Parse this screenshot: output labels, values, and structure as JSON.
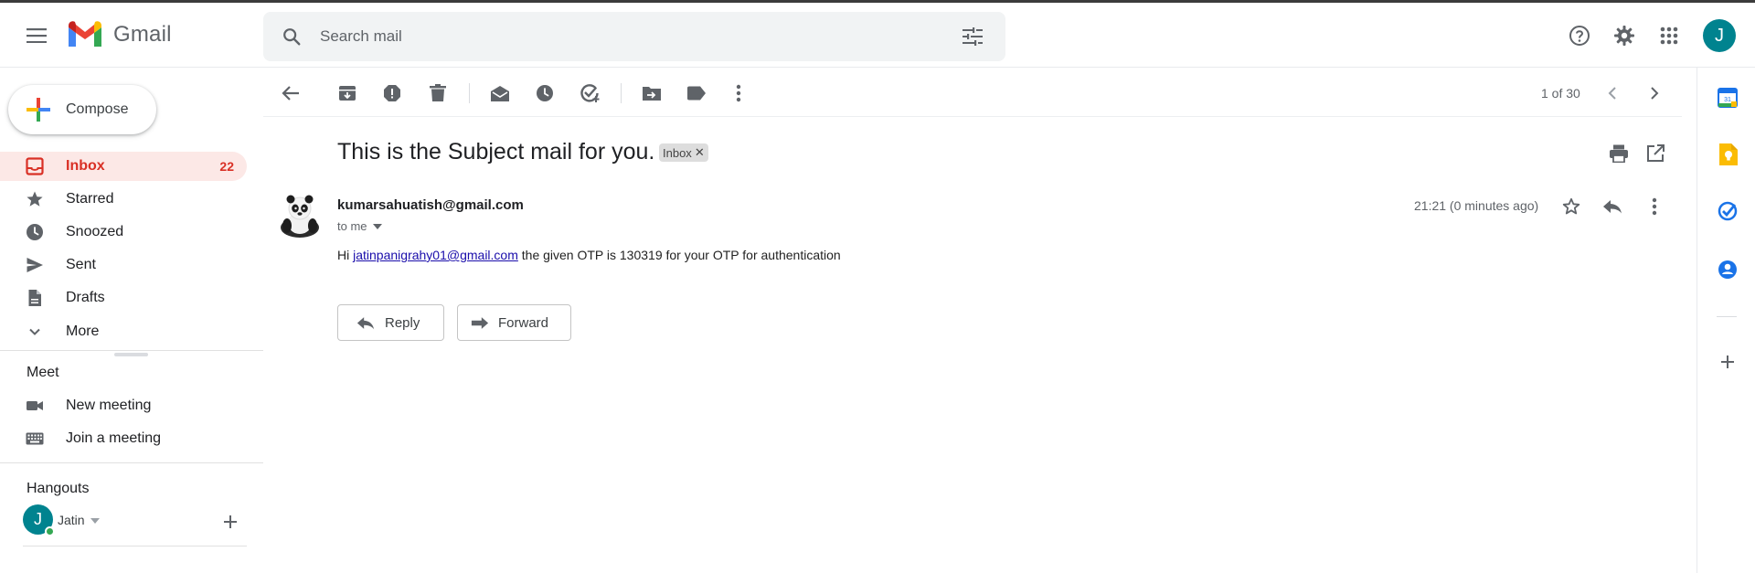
{
  "app": {
    "name": "Gmail"
  },
  "search": {
    "placeholder": "Search mail"
  },
  "account": {
    "initial": "J"
  },
  "compose": {
    "label": "Compose"
  },
  "sidebar": {
    "items": [
      {
        "label": "Inbox",
        "count": "22",
        "icon": "inbox-icon",
        "active": true
      },
      {
        "label": "Starred",
        "icon": "star-icon"
      },
      {
        "label": "Snoozed",
        "icon": "clock-icon"
      },
      {
        "label": "Sent",
        "icon": "send-icon"
      },
      {
        "label": "Drafts",
        "icon": "draft-icon"
      },
      {
        "label": "More",
        "icon": "chevron-down-icon"
      }
    ]
  },
  "meet": {
    "title": "Meet",
    "items": [
      {
        "label": "New meeting",
        "icon": "video-icon"
      },
      {
        "label": "Join a meeting",
        "icon": "keyboard-icon"
      }
    ]
  },
  "hangouts": {
    "title": "Hangouts",
    "user": {
      "initial": "J",
      "name": "Jatin"
    }
  },
  "toolbar": {
    "pager": "1 of 30"
  },
  "message": {
    "subject": "This is the Subject mail for you.",
    "label": "Inbox",
    "sender": "kumarsahuatish@gmail.com",
    "recipient": "to me",
    "time": "21:21 (0 minutes ago)",
    "body_prefix": "Hi ",
    "body_link": "jatinpanigrahy01@gmail.com",
    "body_suffix": " the given OTP is 130319 for your OTP for authentication"
  },
  "actions": {
    "reply": "Reply",
    "forward": "Forward"
  },
  "rail": {
    "calendar_day": "31"
  },
  "colors": {
    "accent": "#d93025",
    "active_bg": "#fce8e6",
    "avatar": "#00838f",
    "link": "#1a0dab"
  }
}
